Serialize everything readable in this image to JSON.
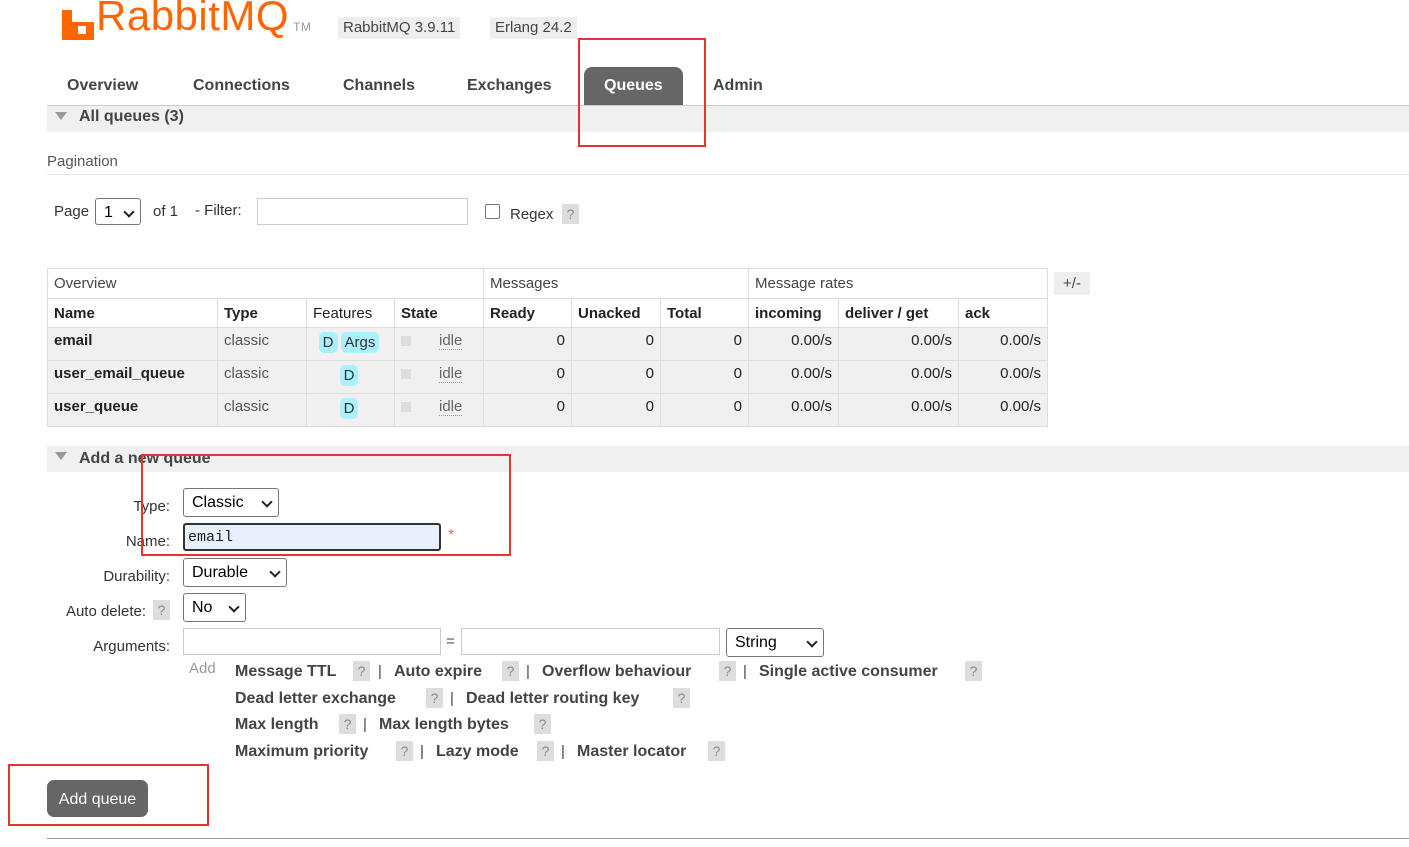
{
  "header": {
    "logo_text": "RabbitMQ",
    "tm": "TM",
    "version_rabbit": "RabbitMQ 3.9.11",
    "version_erlang": "Erlang 24.2"
  },
  "tabs": [
    {
      "label": "Overview"
    },
    {
      "label": "Connections"
    },
    {
      "label": "Channels"
    },
    {
      "label": "Exchanges"
    },
    {
      "label": "Queues",
      "active": true
    },
    {
      "label": "Admin"
    }
  ],
  "all_queues": {
    "title": "All queues (3)"
  },
  "pagination": {
    "title": "Pagination",
    "page_label": "Page",
    "page_value": "1",
    "of_label": "of 1",
    "filter_label": "- Filter:",
    "filter_value": "",
    "regex_label": "Regex",
    "help": "?"
  },
  "table": {
    "groups": [
      "Overview",
      "Messages",
      "Message rates"
    ],
    "toggle": "+/-",
    "columns": [
      "Name",
      "Type",
      "Features",
      "State",
      "Ready",
      "Unacked",
      "Total",
      "incoming",
      "deliver / get",
      "ack"
    ],
    "rows": [
      {
        "name": "email",
        "type": "classic",
        "features": [
          "D",
          "Args"
        ],
        "state": "idle",
        "ready": "0",
        "unacked": "0",
        "total": "0",
        "incoming": "0.00/s",
        "deliver_get": "0.00/s",
        "ack": "0.00/s"
      },
      {
        "name": "user_email_queue",
        "type": "classic",
        "features": [
          "D"
        ],
        "state": "idle",
        "ready": "0",
        "unacked": "0",
        "total": "0",
        "incoming": "0.00/s",
        "deliver_get": "0.00/s",
        "ack": "0.00/s"
      },
      {
        "name": "user_queue",
        "type": "classic",
        "features": [
          "D"
        ],
        "state": "idle",
        "ready": "0",
        "unacked": "0",
        "total": "0",
        "incoming": "0.00/s",
        "deliver_get": "0.00/s",
        "ack": "0.00/s"
      }
    ]
  },
  "add_queue": {
    "title": "Add a new queue",
    "type_label": "Type:",
    "type_value": "Classic",
    "name_label": "Name:",
    "name_value": "email",
    "required_mark": "*",
    "durability_label": "Durability:",
    "durability_value": "Durable",
    "auto_delete_label": "Auto delete:",
    "auto_delete_value": "No",
    "arguments_label": "Arguments:",
    "equals": "=",
    "arg_type_value": "String",
    "add_label": "Add",
    "arg_shortcuts": {
      "message_ttl": "Message TTL",
      "auto_expire": "Auto expire",
      "overflow": "Overflow behaviour",
      "single_active": "Single active consumer",
      "dlx": "Dead letter exchange",
      "dlrk": "Dead letter routing key",
      "max_length": "Max length",
      "max_length_bytes": "Max length bytes",
      "max_priority": "Maximum priority",
      "lazy_mode": "Lazy mode",
      "master_locator": "Master locator"
    },
    "submit_label": "Add queue"
  },
  "colors": {
    "brand": "#ff6600",
    "active_tab": "#666666",
    "annotation": "#e53333",
    "feature_badge": "#aaf0ff"
  }
}
